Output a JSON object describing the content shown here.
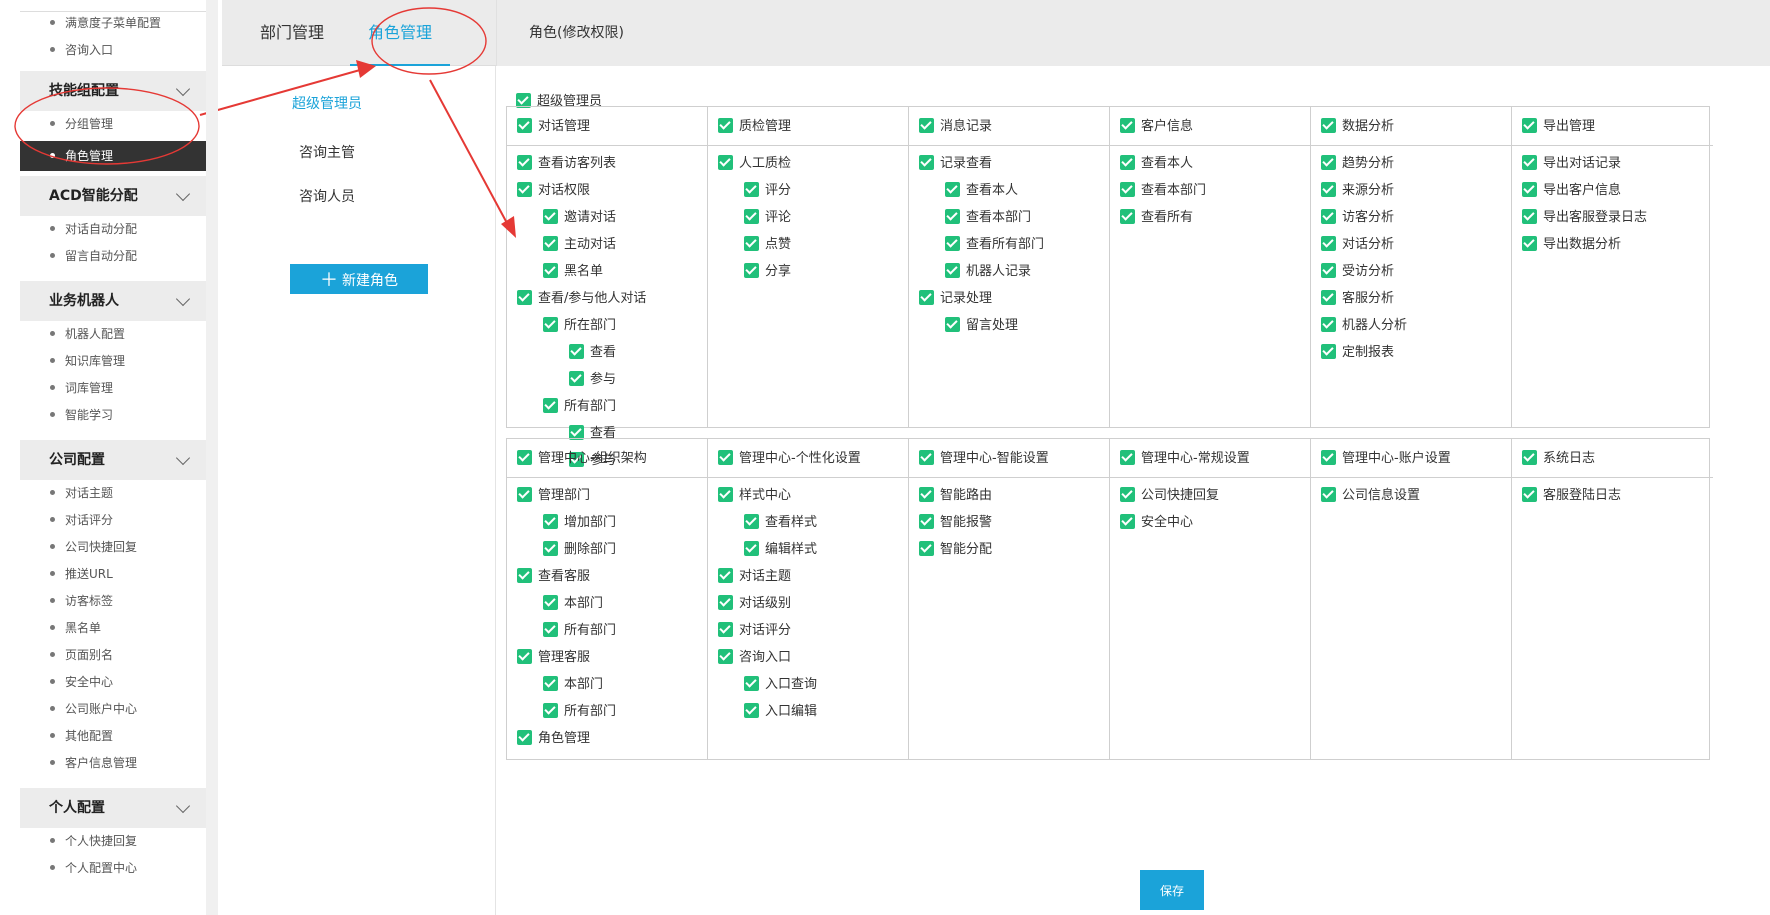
{
  "sidebar": {
    "top_items": [
      "满意度子菜单配置",
      "咨询入口"
    ],
    "groups": [
      {
        "title": "技能组配置",
        "items": [
          "分组管理",
          "角色管理"
        ]
      },
      {
        "title": "ACD智能分配",
        "items": [
          "对话自动分配",
          "留言自动分配"
        ]
      },
      {
        "title": "业务机器人",
        "items": [
          "机器人配置",
          "知识库管理",
          "词库管理",
          "智能学习"
        ]
      },
      {
        "title": "公司配置",
        "items": [
          "对话主题",
          "对话评分",
          "公司快捷回复",
          "推送URL",
          "访客标签",
          "黑名单",
          "页面别名",
          "安全中心",
          "公司账户中心",
          "其他配置",
          "客户信息管理"
        ]
      },
      {
        "title": "个人配置",
        "items": [
          "个人快捷回复",
          "个人配置中心"
        ]
      }
    ],
    "active_item": "角色管理"
  },
  "tabs": {
    "items": [
      "部门管理",
      "角色管理"
    ],
    "active": "角色管理",
    "sub_title": "角色(修改权限)"
  },
  "roles": {
    "items": [
      "超级管理员",
      "咨询主管",
      "咨询人员"
    ],
    "active": "超级管理员",
    "new_role_label": "新建角色"
  },
  "permissions": {
    "super_label": "超级管理员",
    "grid1": [
      {
        "title": "对话管理",
        "items": [
          [
            "查看访客列表",
            0
          ],
          [
            "对话权限",
            0
          ],
          [
            "邀请对话",
            1
          ],
          [
            "主动对话",
            1
          ],
          [
            "黑名单",
            1
          ],
          [
            "查看/参与他人对话",
            0
          ],
          [
            "所在部门",
            1
          ],
          [
            "查看",
            2
          ],
          [
            "参与",
            2
          ],
          [
            "所有部门",
            1
          ],
          [
            "查看",
            2
          ],
          [
            "参与",
            2
          ]
        ]
      },
      {
        "title": "质检管理",
        "items": [
          [
            "人工质检",
            0
          ],
          [
            "评分",
            1
          ],
          [
            "评论",
            1
          ],
          [
            "点赞",
            1
          ],
          [
            "分享",
            1
          ]
        ]
      },
      {
        "title": "消息记录",
        "items": [
          [
            "记录查看",
            0
          ],
          [
            "查看本人",
            1
          ],
          [
            "查看本部门",
            1
          ],
          [
            "查看所有部门",
            1
          ],
          [
            "机器人记录",
            1
          ],
          [
            "记录处理",
            0
          ],
          [
            "留言处理",
            1
          ]
        ]
      },
      {
        "title": "客户信息",
        "items": [
          [
            "查看本人",
            0
          ],
          [
            "查看本部门",
            0
          ],
          [
            "查看所有",
            0
          ]
        ]
      },
      {
        "title": "数据分析",
        "items": [
          [
            "趋势分析",
            0
          ],
          [
            "来源分析",
            0
          ],
          [
            "访客分析",
            0
          ],
          [
            "对话分析",
            0
          ],
          [
            "受访分析",
            0
          ],
          [
            "客服分析",
            0
          ],
          [
            "机器人分析",
            0
          ],
          [
            "定制报表",
            0
          ]
        ]
      },
      {
        "title": "导出管理",
        "items": [
          [
            "导出对话记录",
            0
          ],
          [
            "导出客户信息",
            0
          ],
          [
            "导出客服登录日志",
            0
          ],
          [
            "导出数据分析",
            0
          ]
        ]
      }
    ],
    "grid2": [
      {
        "title": "管理中心-组织架构",
        "items": [
          [
            "管理部门",
            0
          ],
          [
            "增加部门",
            1
          ],
          [
            "删除部门",
            1
          ],
          [
            "查看客服",
            0
          ],
          [
            "本部门",
            1
          ],
          [
            "所有部门",
            1
          ],
          [
            "管理客服",
            0
          ],
          [
            "本部门",
            1
          ],
          [
            "所有部门",
            1
          ],
          [
            "角色管理",
            0
          ]
        ]
      },
      {
        "title": "管理中心-个性化设置",
        "items": [
          [
            "样式中心",
            0
          ],
          [
            "查看样式",
            1
          ],
          [
            "编辑样式",
            1
          ],
          [
            "对话主题",
            0
          ],
          [
            "对话级别",
            0
          ],
          [
            "对话评分",
            0
          ],
          [
            "咨询入口",
            0
          ],
          [
            "入口查询",
            1
          ],
          [
            "入口编辑",
            1
          ]
        ]
      },
      {
        "title": "管理中心-智能设置",
        "items": [
          [
            "智能路由",
            0
          ],
          [
            "智能报警",
            0
          ],
          [
            "智能分配",
            0
          ]
        ]
      },
      {
        "title": "管理中心-常规设置",
        "items": [
          [
            "公司快捷回复",
            0
          ],
          [
            "安全中心",
            0
          ]
        ]
      },
      {
        "title": "管理中心-账户设置",
        "items": [
          [
            "公司信息设置",
            0
          ]
        ]
      },
      {
        "title": "系统日志",
        "items": [
          [
            "客服登陆日志",
            0
          ]
        ]
      }
    ],
    "save_label": "保存"
  },
  "colors": {
    "accent": "#1ba3d9",
    "checkbox": "#21c07a",
    "annotation": "#e53935",
    "sidebar_active": "#333333"
  }
}
